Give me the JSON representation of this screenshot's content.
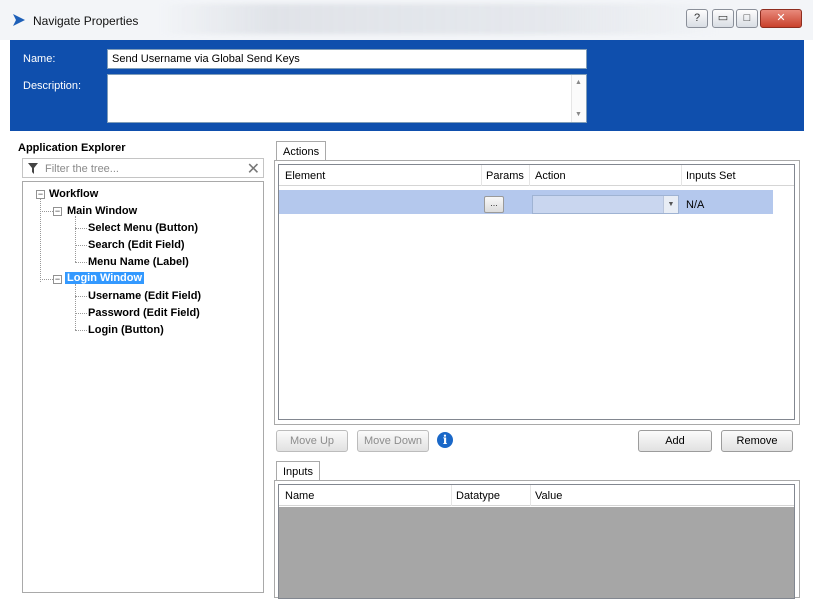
{
  "window": {
    "title": "Navigate Properties"
  },
  "title_buttons": {
    "help": "?",
    "minimize": "▭",
    "maximize": "□",
    "close": "✕"
  },
  "header": {
    "name_label": "Name:",
    "name_value": "Send Username via Global Send Keys",
    "description_label": "Description:",
    "description_value": ""
  },
  "explorer": {
    "title": "Application Explorer",
    "filter_placeholder": "Filter the tree...",
    "tree": {
      "root": "Workflow",
      "main_window": "Main Window",
      "main_children": [
        "Select Menu (Button)",
        "Search (Edit Field)",
        "Menu Name (Label)"
      ],
      "login_window": "Login Window",
      "login_children": [
        "Username (Edit Field)",
        "Password (Edit Field)",
        "Login (Button)"
      ]
    }
  },
  "actions": {
    "tab_label": "Actions",
    "columns": [
      "Element",
      "Params",
      "Action",
      "Inputs Set"
    ],
    "row": {
      "params_button": "...",
      "action_value": "",
      "inputs_set": "N/A"
    }
  },
  "buttons": {
    "move_up": "Move Up",
    "move_down": "Move Down",
    "add": "Add",
    "remove": "Remove"
  },
  "inputs": {
    "tab_label": "Inputs",
    "columns": [
      "Name",
      "Datatype",
      "Value"
    ]
  },
  "colors": {
    "header_blue": "#0f4fad",
    "selection_blue": "#3399ff",
    "row_highlight": "#b4c8ed",
    "info_blue": "#1a68c8"
  }
}
